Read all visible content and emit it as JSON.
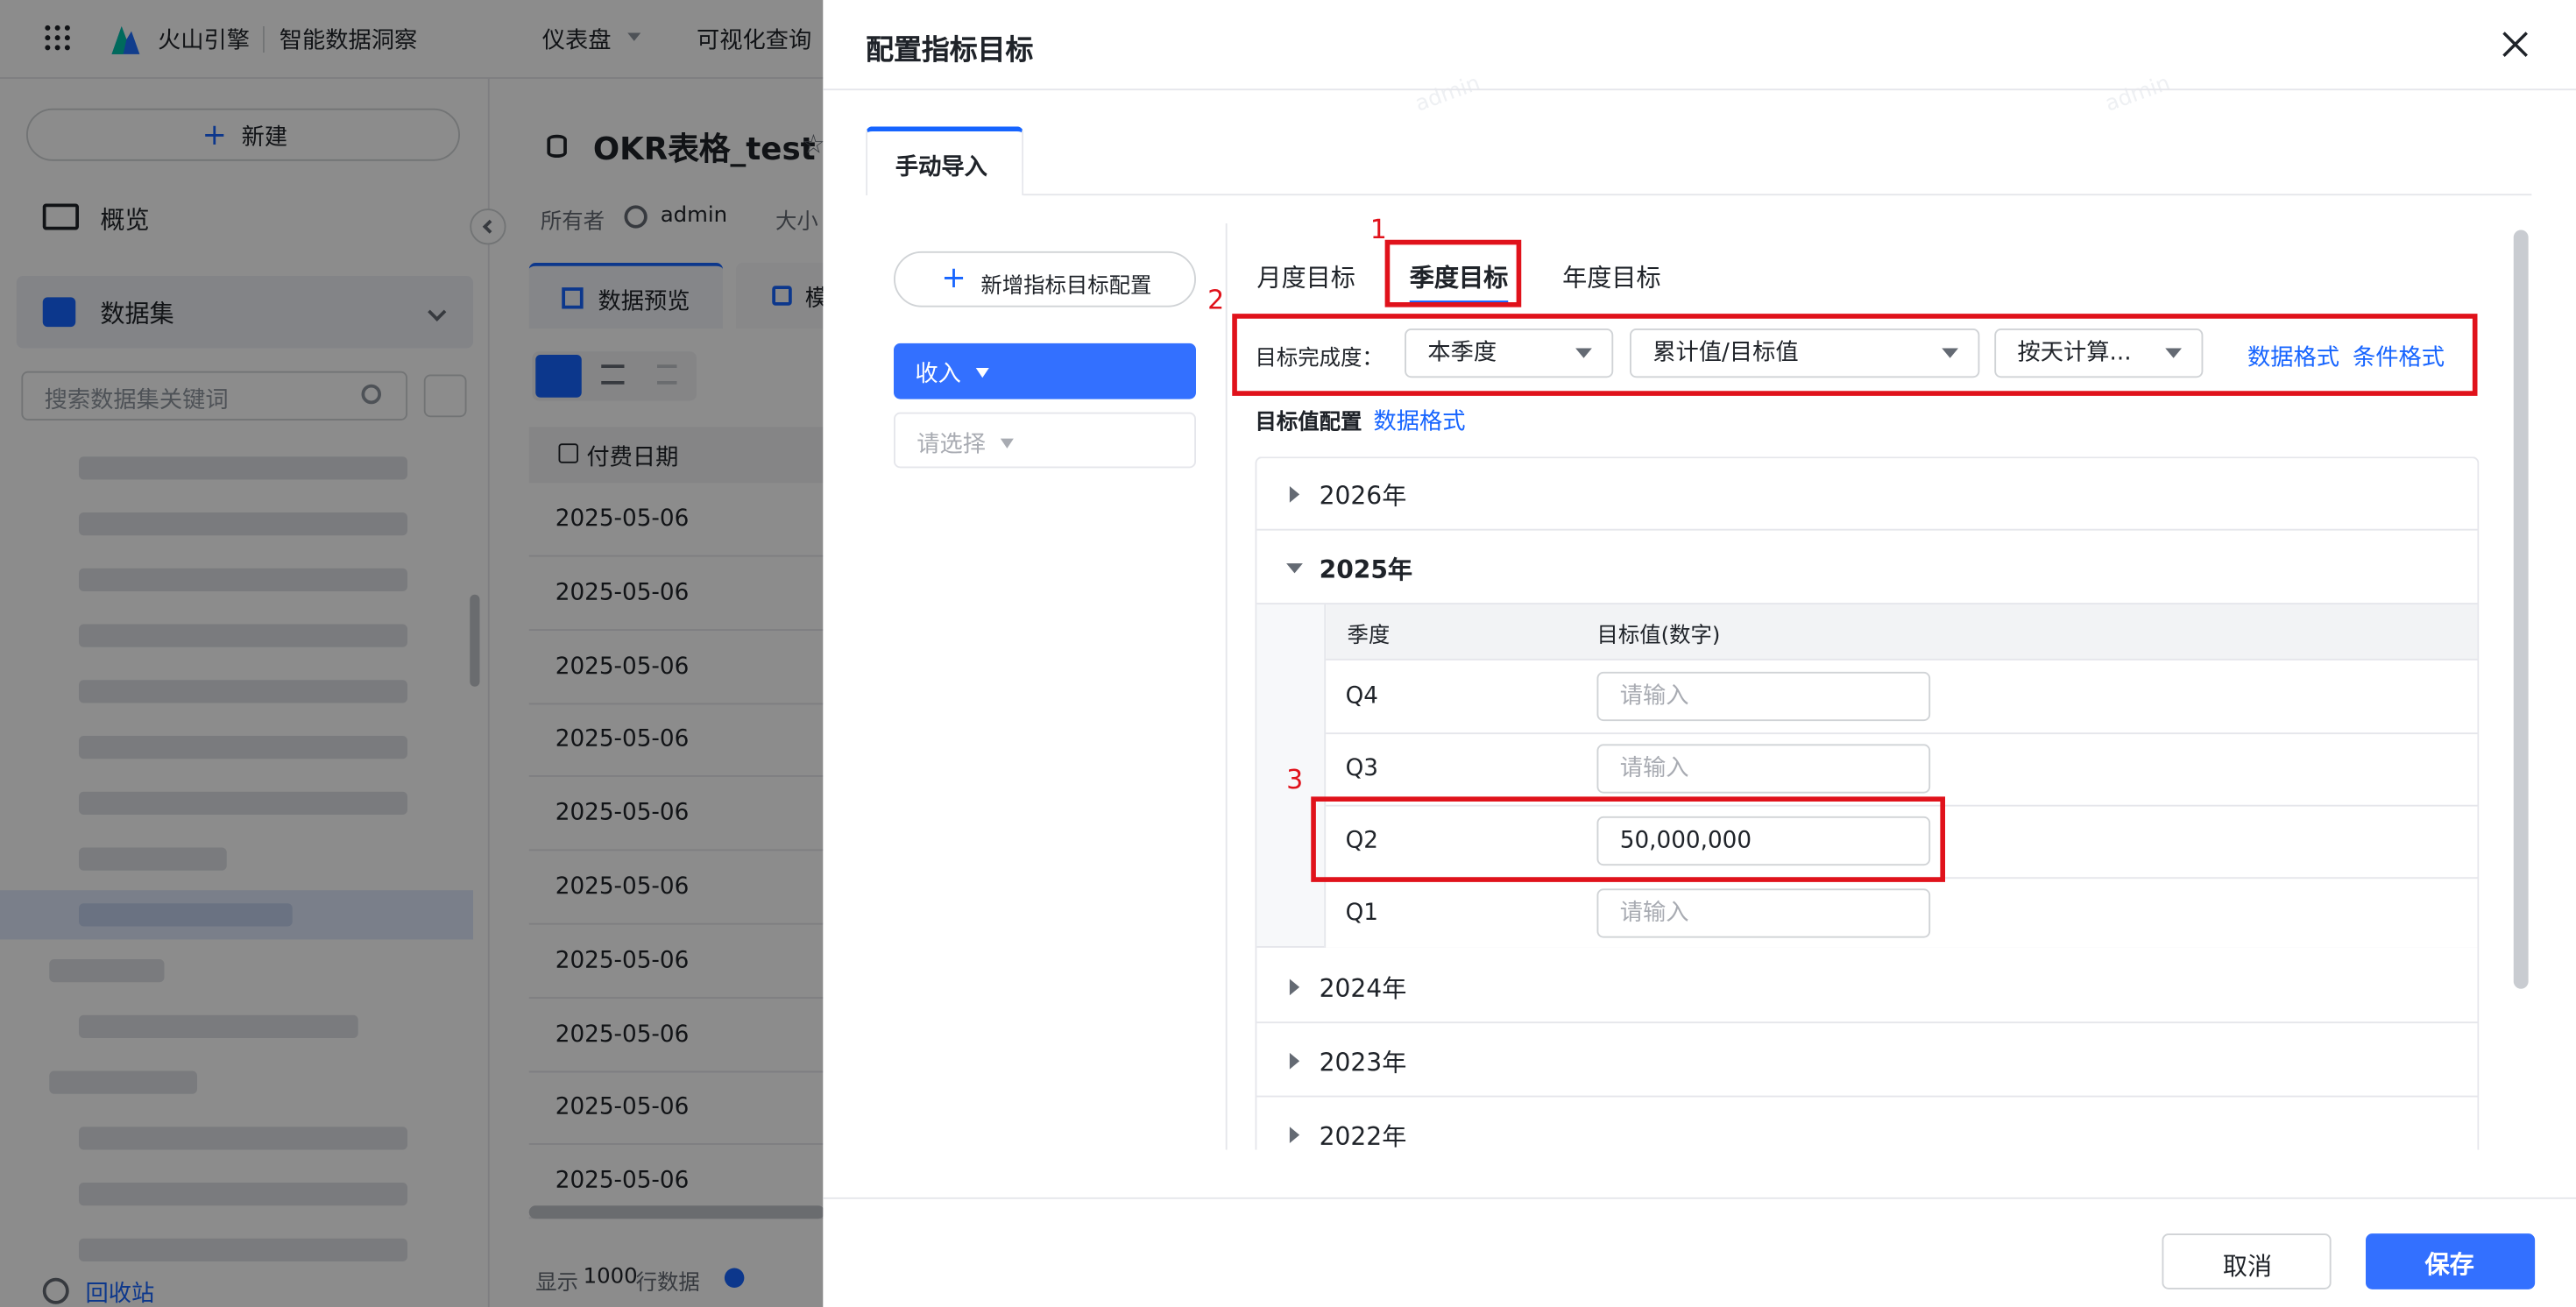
{
  "app": {
    "brand": "火山引擎",
    "product": "智能数据洞察",
    "nav": [
      "仪表盘",
      "可视化查询"
    ],
    "new_button": "新建",
    "sidebar": {
      "overview": "概览",
      "dataset": "数据集",
      "search_placeholder": "搜索数据集关键词",
      "recycle": "回收站"
    },
    "dataset": {
      "title": "OKR表格_test",
      "owner_label": "所有者",
      "owner": "admin",
      "size_label": "大小",
      "tabs": [
        "数据预览",
        "模"
      ],
      "column": "付费日期",
      "rows": [
        "2025-05-06",
        "2025-05-06",
        "2025-05-06",
        "2025-05-06",
        "2025-05-06",
        "2025-05-06",
        "2025-05-06",
        "2025-05-06",
        "2025-05-06",
        "2025-05-06"
      ],
      "footer_prefix": "显示",
      "footer_count": "1000",
      "footer_suffix": "行数据"
    }
  },
  "modal": {
    "title": "配置指标目标",
    "tab": "手动导入",
    "add_button": "新增指标目标配置",
    "metric_button": "收入",
    "select_placeholder": "请选择",
    "period_tabs": [
      "月度目标",
      "季度目标",
      "年度目标"
    ],
    "completion": {
      "label": "目标完成度：",
      "period": "本季度",
      "calc": "累计值/目标值",
      "method": "按天计算...",
      "data_format": "数据格式",
      "cond_format": "条件格式"
    },
    "target_config": {
      "label": "目标值配置",
      "data_format": "数据格式"
    },
    "years": {
      "y2026": "2026年",
      "y2025": "2025年",
      "y2024": "2024年",
      "y2023": "2023年",
      "y2022": "2022年"
    },
    "quarter_table": {
      "col_quarter": "季度",
      "col_value": "目标值(数字)",
      "rows": [
        {
          "q": "Q4",
          "value": "",
          "placeholder": "请输入"
        },
        {
          "q": "Q3",
          "value": "",
          "placeholder": "请输入"
        },
        {
          "q": "Q2",
          "value": "50,000,000",
          "placeholder": "请输入"
        },
        {
          "q": "Q1",
          "value": "",
          "placeholder": "请输入"
        }
      ]
    },
    "annotations": [
      "1",
      "2",
      "3"
    ],
    "watermark": "admin",
    "cancel": "取消",
    "save": "保存"
  },
  "colors": {
    "primary": "#1664ff",
    "mark_red": "#e0121b",
    "button_blue": "#3370ff"
  }
}
